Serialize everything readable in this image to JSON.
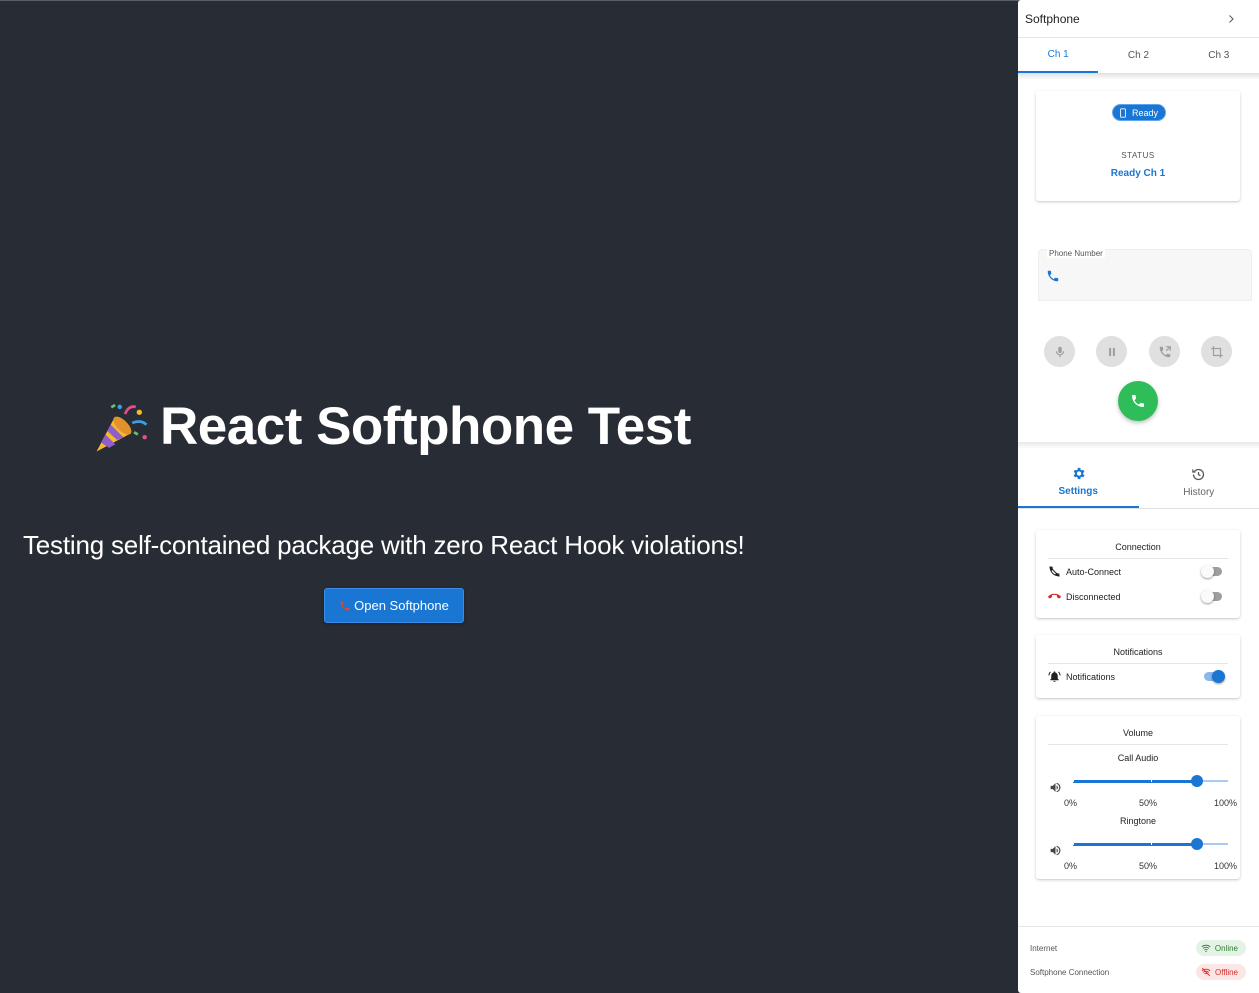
{
  "app": {
    "title": "React Softphone Test",
    "subtitle": "Testing self-contained package with zero React Hook violations!",
    "open_button": {
      "icon": "phone-emoji",
      "label": "Open Softphone"
    },
    "title_icon": "party-popper-emoji"
  },
  "drawer": {
    "title": "Softphone",
    "channel_tabs": [
      {
        "label": "Ch 1",
        "active": true
      },
      {
        "label": "Ch 2",
        "active": false
      },
      {
        "label": "Ch 3",
        "active": false
      }
    ],
    "status_card": {
      "chip_label": "Ready",
      "status_label": "STATUS",
      "status_value": "Ready Ch 1"
    },
    "phone_input": {
      "label": "Phone Number",
      "value": ""
    },
    "controls": [
      "mic-icon",
      "pause-icon",
      "transfer-icon",
      "crop-icon",
      "call-icon"
    ],
    "section_tabs": [
      {
        "label": "Settings",
        "icon": "gear-icon",
        "active": true
      },
      {
        "label": "History",
        "icon": "history-icon",
        "active": false
      }
    ],
    "connection": {
      "title": "Connection",
      "items": [
        {
          "label": "Auto-Connect",
          "icon": "phone-disabled-icon",
          "on": false
        },
        {
          "label": "Disconnected",
          "icon": "call-end-icon",
          "on": false
        }
      ]
    },
    "notifications": {
      "title": "Notifications",
      "items": [
        {
          "label": "Notifications",
          "icon": "bell-active-icon",
          "on": true
        }
      ]
    },
    "volume": {
      "title": "Volume",
      "sliders": [
        {
          "label": "Call Audio",
          "value_percent": 80,
          "marks": [
            "0%",
            "50%",
            "100%"
          ]
        },
        {
          "label": "Ringtone",
          "value_percent": 80,
          "marks": [
            "0%",
            "50%",
            "100%"
          ]
        }
      ]
    },
    "footer": {
      "internet_label": "Internet",
      "internet_status": "Online",
      "connection_label": "Softphone Connection",
      "connection_status": "Offline"
    },
    "colors": {
      "primary": "#1976d2",
      "call_green": "#2ebd59",
      "background": "#282c34",
      "online": "#2e7d32",
      "offline": "#d32f2f"
    }
  }
}
